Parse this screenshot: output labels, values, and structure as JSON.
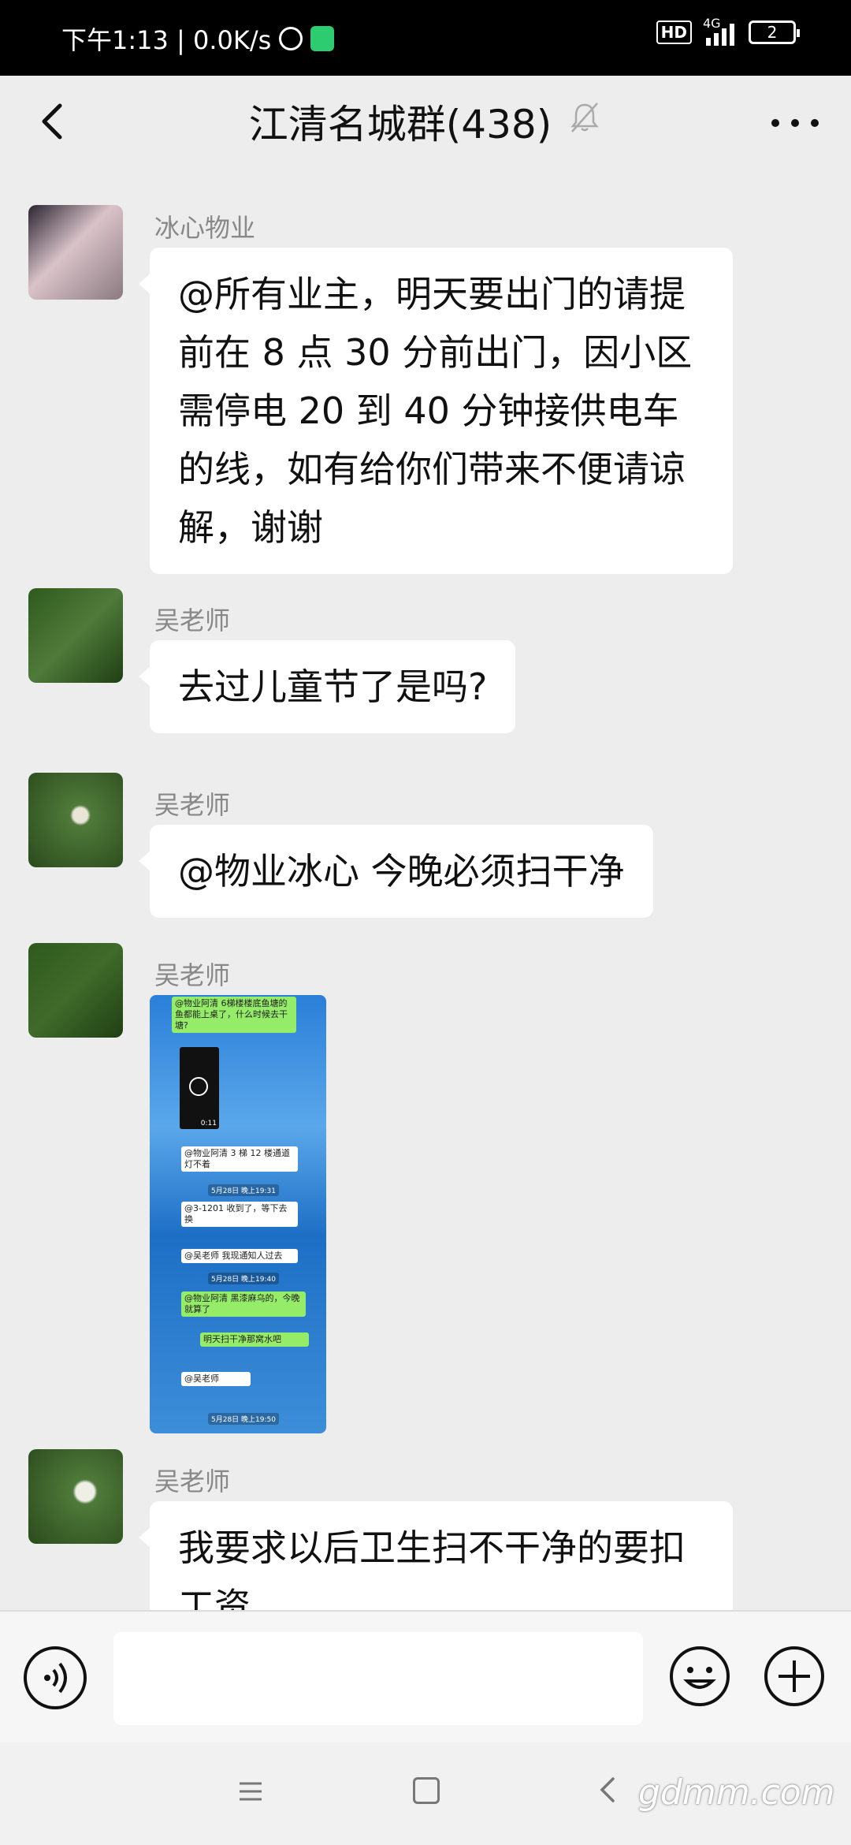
{
  "status_bar": {
    "time_speed": "下午1:13 | 0.0K/s",
    "hd": "HD",
    "network": "4G",
    "battery": "2"
  },
  "header": {
    "title": "江清名城群(438)"
  },
  "messages": [
    {
      "sender": "冰心物业",
      "text": "@所有业主，明天要出门的请提前在 8 点 30 分前出门，因小区需停电 20 到 40 分钟接供电车的线，如有给你们带来不便请谅解，谢谢"
    },
    {
      "sender": "吴老师",
      "text": "去过儿童节了是吗?"
    },
    {
      "sender": "吴老师",
      "text": "@物业冰心  今晚必须扫干净"
    },
    {
      "sender": "吴老师",
      "image": {
        "lines": [
          "@物业阿清 6梯楼楼底鱼塘的鱼都能上桌了，什么时候去干塘?",
          "0:11",
          "@物业阿清 3 梯 12 楼通道灯不着",
          "5月28日 晚上19:31",
          "@3-1201 收到了，等下去换",
          "@吴老师  我现通知人过去",
          "5月28日 晚上19:40",
          "@物业阿清 黑漆麻乌的，今晚就算了",
          "明天扫干净那窝水吧",
          "@吴老师",
          "5月28日 晚上19:50"
        ]
      }
    },
    {
      "sender": "吴老师",
      "text": "我要求以后卫生扫不干净的要扣工资"
    }
  ],
  "navbar": {
    "watermark": "gdmm.com"
  }
}
